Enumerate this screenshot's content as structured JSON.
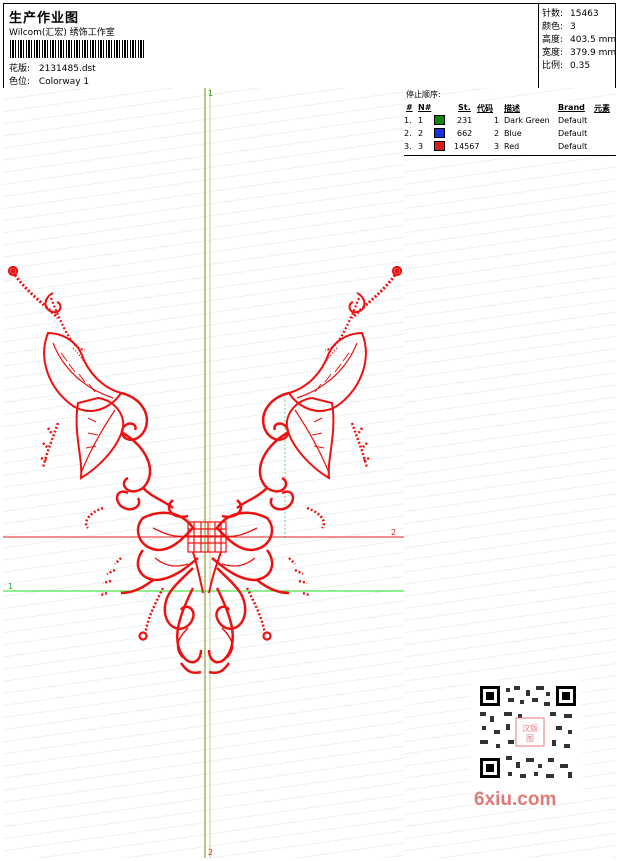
{
  "header": {
    "title": "生产作业图",
    "company": "Wilcom(汇宏) 绣饰工作室",
    "design_label": "花版:",
    "design_value": "2131485.dst",
    "color_label": "色位:",
    "color_value": "Colorway 1"
  },
  "stats": [
    {
      "label": "针数:",
      "value": "15463"
    },
    {
      "label": "颜色:",
      "value": "3"
    },
    {
      "label": "高度:",
      "value": "403.5 mm"
    },
    {
      "label": "宽度:",
      "value": "379.9 mm"
    },
    {
      "label": "比例:",
      "value": "0.35"
    }
  ],
  "stop_sequence": {
    "heading": "停止顺序:",
    "columns": [
      "#",
      "N#",
      "St.",
      "代码",
      "描述",
      "Brand",
      "元素"
    ],
    "rows": [
      {
        "n": "1.",
        "nn": "1",
        "color": "#0a8a0a",
        "st": "231",
        "code": "1",
        "desc": "Dark Green",
        "brand": "Default"
      },
      {
        "n": "2.",
        "nn": "2",
        "color": "#1a2ee0",
        "st": "662",
        "code": "2",
        "desc": "Blue",
        "brand": "Default"
      },
      {
        "n": "3.",
        "nn": "3",
        "color": "#e01a1a",
        "st": "14567",
        "code": "3",
        "desc": "Red",
        "brand": "Default"
      }
    ]
  },
  "axes": {
    "v_top": "1",
    "v_bottom": "2",
    "h_red_right": "2",
    "h_green_left": "1"
  },
  "embroidery_color": "#ee1111",
  "watermark": "6xiu.com",
  "seal_text": "汉版图"
}
